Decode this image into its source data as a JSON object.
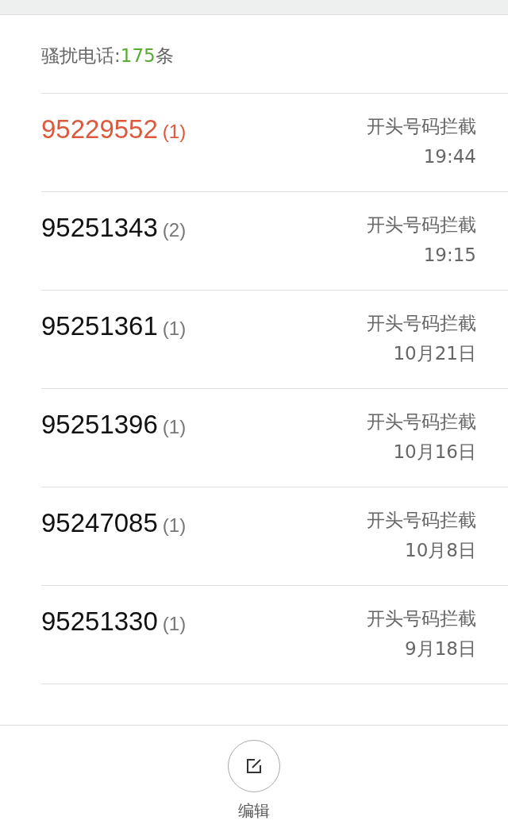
{
  "header": {
    "label": "骚扰电话:",
    "count": "175",
    "unit": "条"
  },
  "calls": [
    {
      "number": "95229552",
      "times": "(1)",
      "unread": true,
      "reason": "开头号码拦截",
      "time": "19:44"
    },
    {
      "number": "95251343",
      "times": "(2)",
      "unread": false,
      "reason": "开头号码拦截",
      "time": "19:15"
    },
    {
      "number": "95251361",
      "times": "(1)",
      "unread": false,
      "reason": "开头号码拦截",
      "time": "10月21日"
    },
    {
      "number": "95251396",
      "times": "(1)",
      "unread": false,
      "reason": "开头号码拦截",
      "time": "10月16日"
    },
    {
      "number": "95247085",
      "times": "(1)",
      "unread": false,
      "reason": "开头号码拦截",
      "time": "10月8日"
    },
    {
      "number": "95251330",
      "times": "(1)",
      "unread": false,
      "reason": "开头号码拦截",
      "time": "9月18日"
    }
  ],
  "toolbar": {
    "edit_label": "编辑"
  }
}
